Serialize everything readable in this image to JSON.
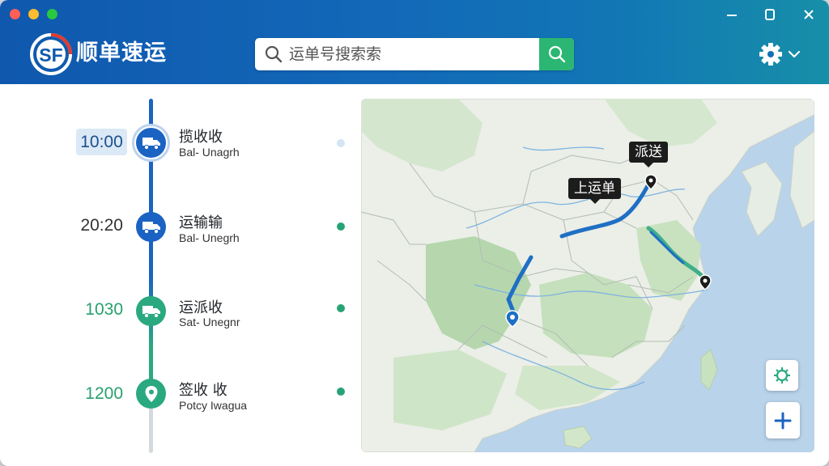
{
  "app": {
    "brand_logo_text": "SF",
    "brand_name": "顺单速运"
  },
  "search": {
    "placeholder": "运单号搜索索"
  },
  "timeline": [
    {
      "time": "10:00",
      "title": "揽收收",
      "subtitle": "Bal- Unagrh",
      "icon": "truck-icon",
      "active": true
    },
    {
      "time": "20:20",
      "title": "运输输",
      "subtitle": "Bal- Unegrh",
      "icon": "truck-icon",
      "active": false
    },
    {
      "time": "1030",
      "title": "运派收",
      "subtitle": "Sat- Unegnr",
      "icon": "truck-icon",
      "active": false
    },
    {
      "time": "1200",
      "title": "签收 收",
      "subtitle": "Potcy Iwagua",
      "icon": "location-pin-icon",
      "active": false
    }
  ],
  "map": {
    "labels": {
      "delivery": "派送",
      "shipment": "上运单"
    },
    "controls": [
      "gear-icon",
      "plus-icon"
    ]
  },
  "colors": {
    "header_blue": "#1368b8",
    "accent_green": "#2bb673",
    "timeline_blue": "#1b63c3",
    "timeline_green": "#2aa981",
    "route_blue": "#1f6fc4"
  }
}
